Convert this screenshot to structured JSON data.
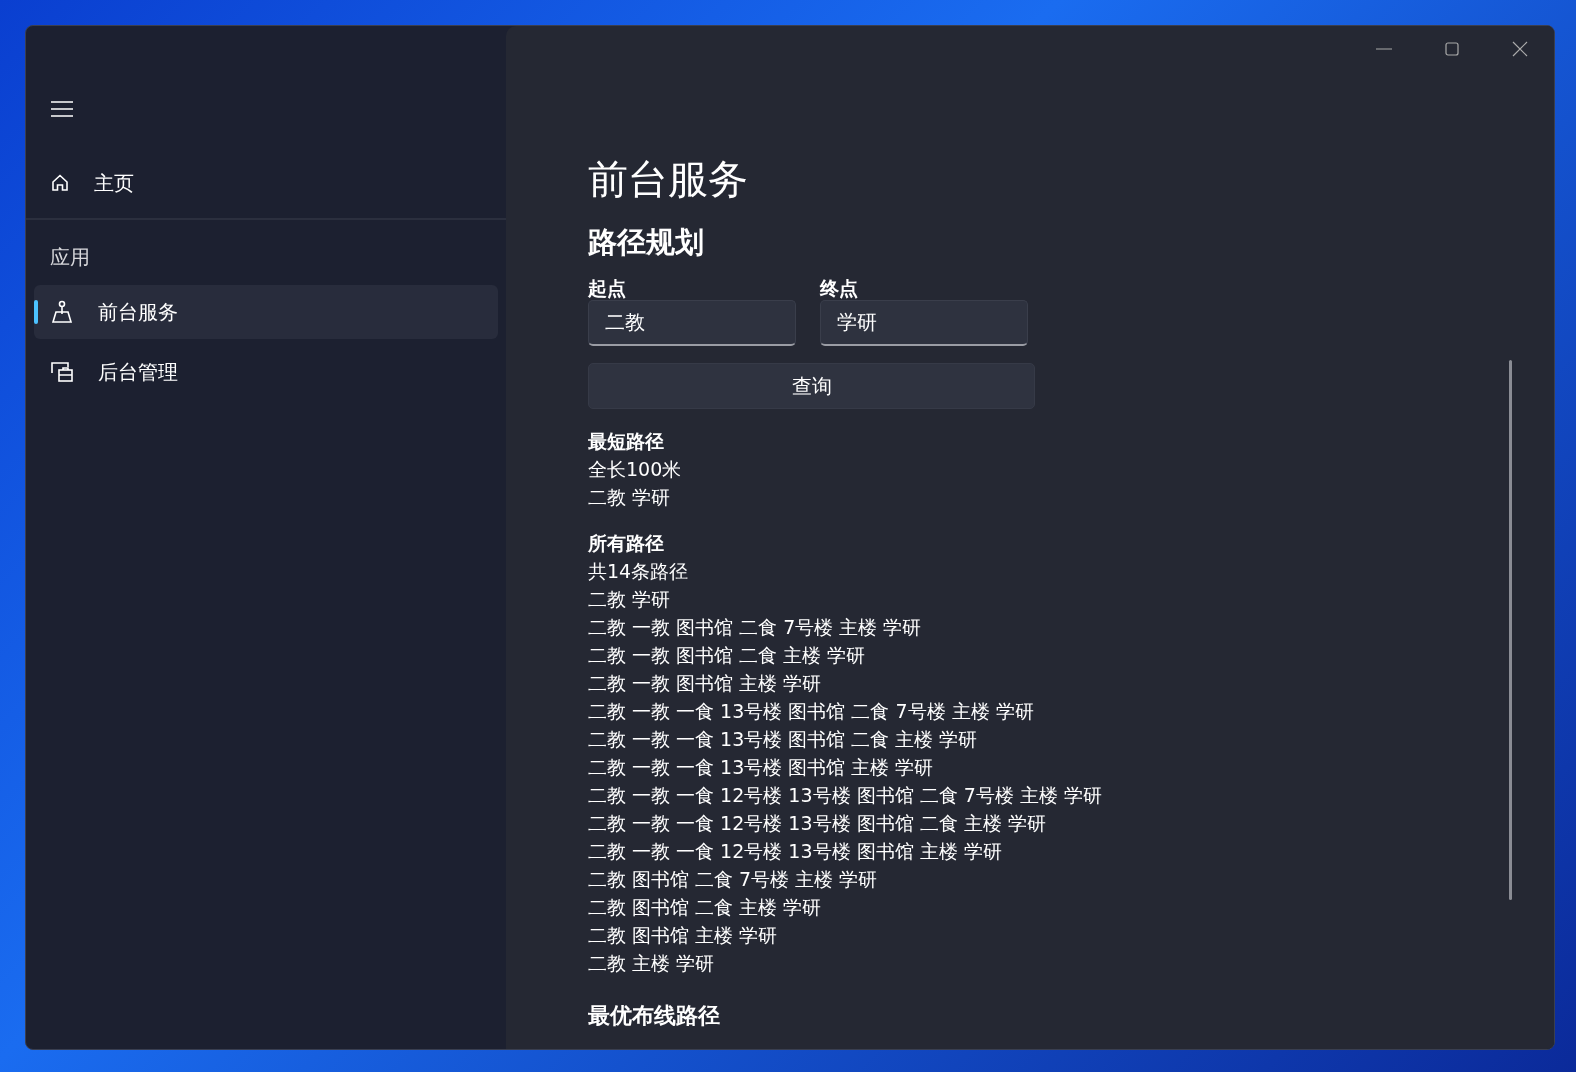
{
  "nav": {
    "items": [
      {
        "label": "主页",
        "kind": "home",
        "selected": false
      }
    ],
    "section_header": "应用",
    "app_items": [
      {
        "label": "前台服务",
        "kind": "map",
        "selected": true
      },
      {
        "label": "后台管理",
        "kind": "admin",
        "selected": false
      }
    ]
  },
  "page": {
    "title": "前台服务",
    "section": "路径规划",
    "start": {
      "label": "起点",
      "value": "二教"
    },
    "end": {
      "label": "终点",
      "value": "学研"
    },
    "query_button": "查询",
    "shortest": {
      "heading": "最短路径",
      "lines": [
        "全长100米",
        "二教 学研"
      ]
    },
    "all": {
      "heading": "所有路径",
      "lines": [
        "共14条路径",
        "二教 学研",
        "二教 一教 图书馆 二食 7号楼 主楼 学研",
        "二教 一教 图书馆 二食 主楼 学研",
        "二教 一教 图书馆 主楼 学研",
        "二教 一教 一食 13号楼 图书馆 二食 7号楼 主楼 学研",
        "二教 一教 一食 13号楼 图书馆 二食 主楼 学研",
        "二教 一教 一食 13号楼 图书馆 主楼 学研",
        "二教 一教 一食 12号楼 13号楼 图书馆 二食 7号楼 主楼 学研",
        "二教 一教 一食 12号楼 13号楼 图书馆 二食 主楼 学研",
        "二教 一教 一食 12号楼 13号楼 图书馆 主楼 学研",
        "二教 图书馆 二食 7号楼 主楼 学研",
        "二教 图书馆 二食 主楼 学研",
        "二教 图书馆 主楼 学研",
        "二教 主楼 学研"
      ]
    },
    "next_heading": "最优布线路径"
  }
}
